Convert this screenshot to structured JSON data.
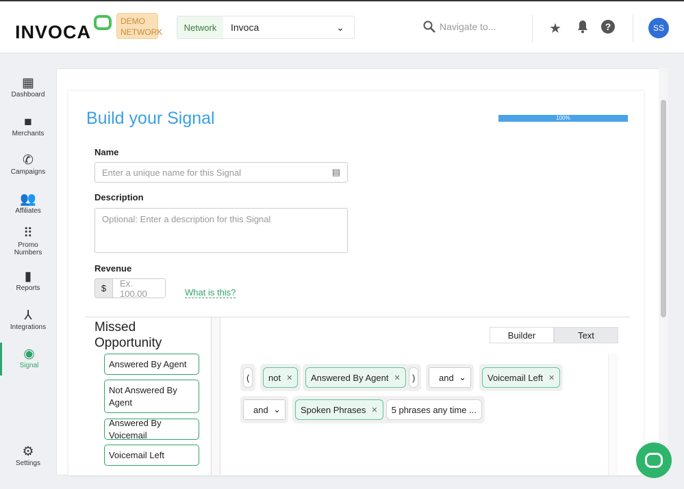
{
  "header": {
    "logo": "INVOCA",
    "badge": "DEMO NETWORK",
    "network_label": "Network",
    "network_value": "Invoca",
    "search_placeholder": "Navigate to...",
    "avatar": "SS"
  },
  "sidebar": {
    "items": [
      {
        "label": "Dashboard",
        "icon": "dashboard-icon"
      },
      {
        "label": "Merchants",
        "icon": "folder-icon"
      },
      {
        "label": "Campaigns",
        "icon": "phone-forward-icon"
      },
      {
        "label": "Affiliates",
        "icon": "people-icon"
      },
      {
        "label": "Promo Numbers",
        "icon": "keypad-icon"
      },
      {
        "label": "Reports",
        "icon": "bar-chart-icon"
      },
      {
        "label": "Integrations",
        "icon": "network-icon"
      },
      {
        "label": "Signal",
        "icon": "compass-icon",
        "active": true
      },
      {
        "label": "Settings",
        "icon": "gear-icon"
      }
    ]
  },
  "main": {
    "title": "Build your Signal",
    "progress": 100,
    "progress_label": "100%",
    "name_label": "Name",
    "name_placeholder": "Enter a unique name for this Signal",
    "description_label": "Description",
    "description_placeholder": "Optional: Enter a description for this Signal",
    "revenue_label": "Revenue",
    "currency": "$",
    "revenue_placeholder": "Ex. 100.00",
    "what_link": "What is this?"
  },
  "builder": {
    "category": "Missed Opportunity",
    "conditions": [
      "Answered By Agent",
      "Not Answered By Agent",
      "Answered By Voicemail",
      "Voicemail Left"
    ],
    "tabs": [
      "Builder",
      "Text"
    ],
    "row1": {
      "open": "(",
      "not": "not",
      "cond1": "Answered By Agent",
      "close": ")",
      "op": "and",
      "cond2": "Voicemail Left"
    },
    "row2": {
      "op": "and",
      "cond": "Spoken Phrases",
      "detail": "5 phrases any time ..."
    }
  },
  "colors": {
    "accent": "#3aa0e0",
    "green": "#2fa36b",
    "progress": "#4aa3e8"
  }
}
